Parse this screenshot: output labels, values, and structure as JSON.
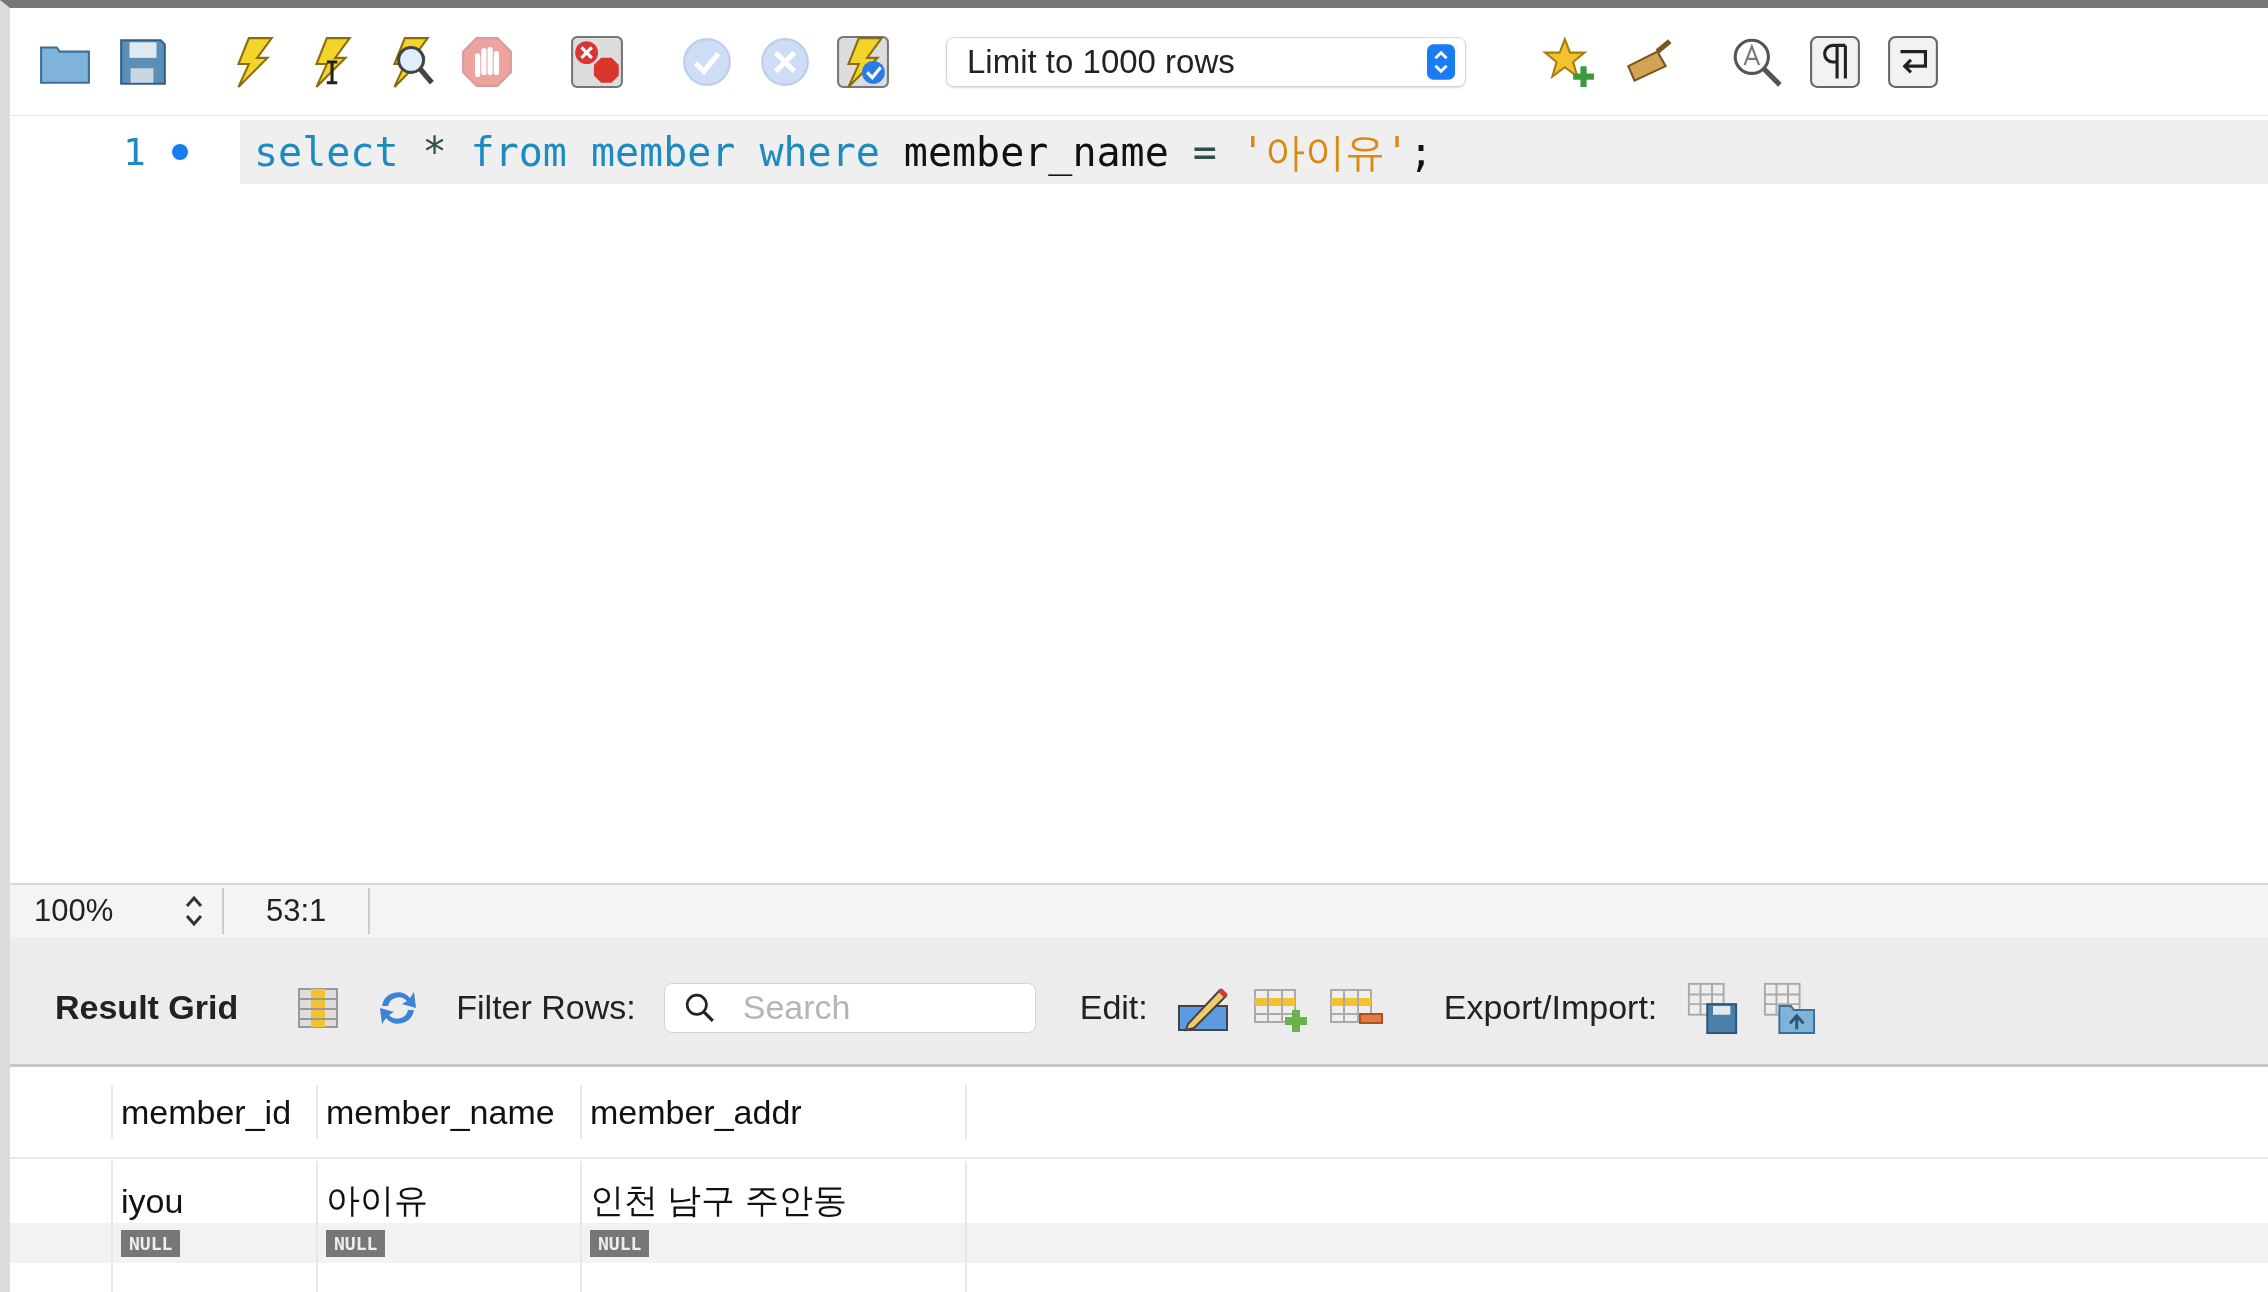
{
  "toolbar": {
    "groups": [
      {
        "buttons": [
          {
            "kind": "folder",
            "disabled": false
          },
          {
            "kind": "save",
            "disabled": false
          }
        ]
      },
      {
        "buttons": [
          {
            "kind": "bolt",
            "disabled": false
          },
          {
            "kind": "bolt-cursor",
            "disabled": false
          },
          {
            "kind": "bolt-magnifier",
            "disabled": false
          },
          {
            "kind": "stop",
            "disabled": true
          }
        ]
      },
      {
        "buttons": [
          {
            "kind": "stop-error",
            "disabled": false
          }
        ]
      },
      {
        "buttons": [
          {
            "kind": "check",
            "disabled": true
          },
          {
            "kind": "cross",
            "disabled": true
          },
          {
            "kind": "bolt-check",
            "disabled": false
          }
        ]
      }
    ],
    "limit_dropdown": {
      "value": "Limit to 1000 rows"
    },
    "groups_after": [
      {
        "buttons": [
          {
            "kind": "star-plus",
            "disabled": false
          },
          {
            "kind": "broom",
            "disabled": false
          }
        ]
      },
      {
        "buttons": [
          {
            "kind": "find",
            "disabled": false
          },
          {
            "kind": "pilcrow",
            "disabled": false
          },
          {
            "kind": "wrap",
            "disabled": false
          }
        ]
      }
    ]
  },
  "editor": {
    "lines": [
      {
        "number": "1",
        "marker": true,
        "tokens": [
          {
            "kind": "keyword",
            "text": "select"
          },
          {
            "kind": "operator",
            "text": "*"
          },
          {
            "kind": "keyword",
            "text": "from"
          },
          {
            "kind": "keyword",
            "text": "member"
          },
          {
            "kind": "keyword",
            "text": "where"
          },
          {
            "kind": "identifier",
            "text": "member_name"
          },
          {
            "kind": "operator",
            "text": "="
          },
          {
            "kind": "string",
            "text": "'아이유'"
          },
          {
            "kind": "punctuation",
            "text": ";"
          }
        ]
      }
    ]
  },
  "status_bar": {
    "zoom": "100%",
    "position": "53:1"
  },
  "result_toolbar": {
    "title": "Result Grid",
    "filter_label": "Filter Rows:",
    "search": {
      "placeholder": "Search"
    },
    "edit_label": "Edit:",
    "export_label": "Export/Import:"
  },
  "table": {
    "columns": [
      "member_id",
      "member_name",
      "member_addr"
    ],
    "rows": [
      {
        "kind": "data",
        "cells": [
          "iyou",
          "아이유",
          "인천 남구 주안동"
        ]
      },
      {
        "kind": "new",
        "cells": [
          "NULL",
          "NULL",
          "NULL"
        ]
      }
    ]
  }
}
